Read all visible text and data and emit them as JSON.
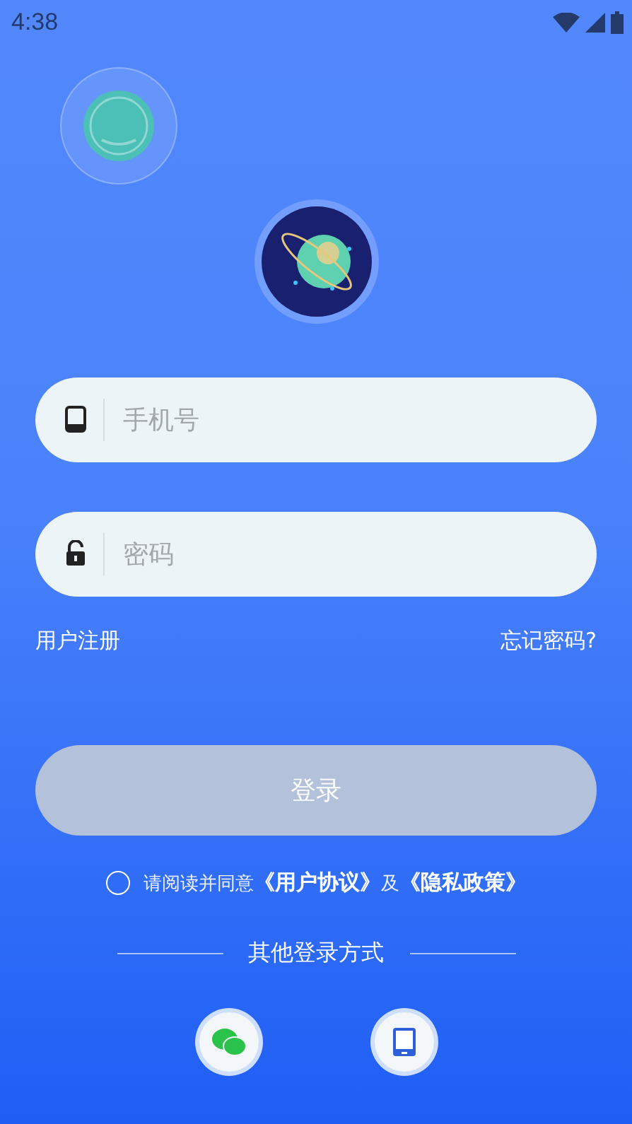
{
  "status_bar": {
    "time": "4:38"
  },
  "fields": [
    {
      "kind": "phone",
      "placeholder": "手机号"
    },
    {
      "kind": "password",
      "placeholder": "密码"
    }
  ],
  "links": {
    "register": "用户注册",
    "forgot": "忘记密码?"
  },
  "login_button": {
    "label": "登录",
    "disabled": true
  },
  "agreement": {
    "checked": false,
    "prefix": "请阅读并同意",
    "links": [
      "《用户协议》",
      "《隐私政策》"
    ],
    "joiner": "及"
  },
  "other_login": {
    "title": "其他登录方式",
    "methods": [
      {
        "kind": "wechat"
      },
      {
        "kind": "phone"
      }
    ]
  }
}
